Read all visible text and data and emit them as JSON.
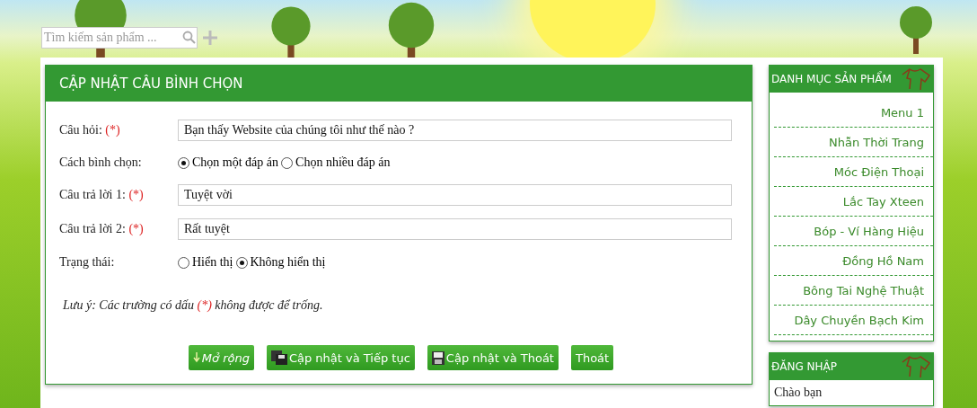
{
  "search": {
    "placeholder": "Tìm kiếm sản phẩm ..."
  },
  "form": {
    "title": "CẬP NHẬT CÂU BÌNH CHỌN",
    "rows": [
      {
        "kind": "text",
        "label": "Câu hỏi:",
        "required": "(*)",
        "value": "Bạn thấy Website của chúng tôi như thế nào ?"
      },
      {
        "kind": "radio",
        "label": "Cách bình chọn:",
        "options": [
          {
            "label": "Chọn một đáp án",
            "selected": true
          },
          {
            "label": "Chọn nhiều đáp án",
            "selected": false
          }
        ]
      },
      {
        "kind": "text",
        "label": "Câu trả lời 1:",
        "required": "(*)",
        "value": "Tuyệt vời"
      },
      {
        "kind": "text",
        "label": "Câu trả lời 2:",
        "required": "(*)",
        "value": "Rất tuyệt"
      },
      {
        "kind": "radio",
        "label": "Trạng thái:",
        "options": [
          {
            "label": "Hiển thị",
            "selected": false
          },
          {
            "label": "Không hiển thị",
            "selected": true
          }
        ]
      }
    ],
    "note_parts": [
      "Lưu ý: Các trường có dấu",
      "(*)",
      "không được để trống."
    ],
    "buttons": [
      {
        "kind": "expand",
        "label": "Mở rộng"
      },
      {
        "kind": "save-continue",
        "label": "Cập nhật và Tiếp tục"
      },
      {
        "kind": "save",
        "label": "Cập nhật và Thoát"
      },
      {
        "kind": "plain",
        "label": "Thoát"
      }
    ]
  },
  "sidebar": [
    {
      "title": "DANH MỤC SẢN PHẨM",
      "items": [
        "Menu 1",
        "Nhẫn Thời Trang",
        "Móc Điện Thoại",
        "Lắc Tay Xteen",
        "Bóp - Ví Hàng Hiệu",
        "Đồng Hồ Nam",
        "Bông Tai Nghệ Thuật",
        "Dây Chuyền Bạch Kim"
      ]
    },
    {
      "title": "ĐĂNG NHẬP",
      "text": "Chào bạn"
    }
  ]
}
